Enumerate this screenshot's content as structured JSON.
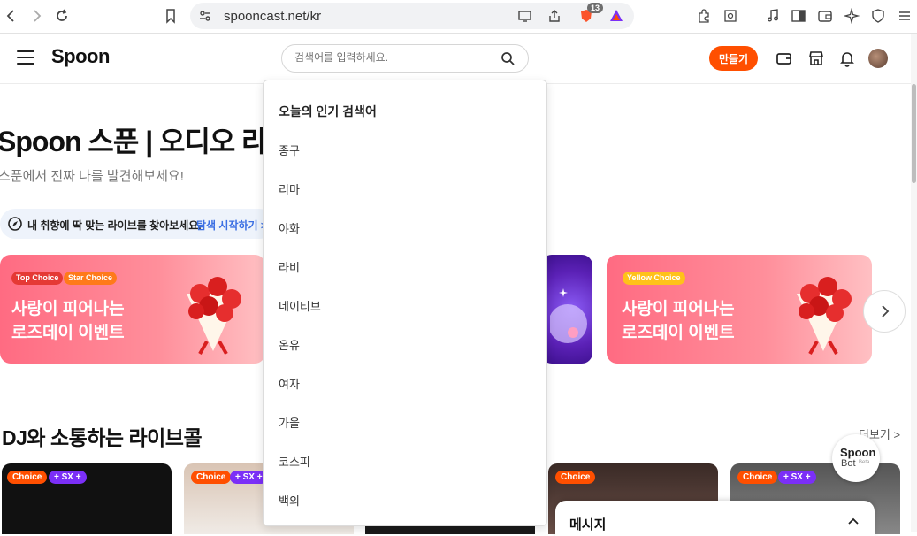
{
  "browser": {
    "url": "spooncast.net/kr",
    "shield_count": "13"
  },
  "header": {
    "logo": "Spoon",
    "search_placeholder": "검색어를 입력하세요.",
    "make_label": "만들기"
  },
  "hero": {
    "title": "Spoon 스푼 | 오디오 라",
    "subtitle": "스푼에서 진짜 나를 발견해보세요!",
    "explore_text": "내 취향에 딱 맞는 라이브를 찾아보세요.",
    "explore_link": "탐색 시작하기 >"
  },
  "banners": [
    {
      "tags": [
        "Top Choice",
        "Star Choice"
      ],
      "title": "사랑이 피어나는\n로즈데이 이벤트"
    },
    {
      "tags": [
        "Yellow Choice"
      ],
      "title": "사랑이 피어나는\n로즈데이 이벤트"
    }
  ],
  "section": {
    "title": "DJ와 소통하는 라이브콜",
    "more": "더보기 >"
  },
  "cards": {
    "choice_label": "Choice",
    "sx_label": "+ SX +"
  },
  "spoonbot": {
    "line1": "Spoon",
    "line2": "Bot",
    "beta": "Beta"
  },
  "message_panel": {
    "title": "메시지"
  },
  "dropdown": {
    "heading": "오늘의 인기 검색어",
    "items": [
      "종구",
      "리마",
      "야화",
      "라비",
      "네이티브",
      "온유",
      "여자",
      "가을",
      "코스피",
      "백의"
    ]
  }
}
